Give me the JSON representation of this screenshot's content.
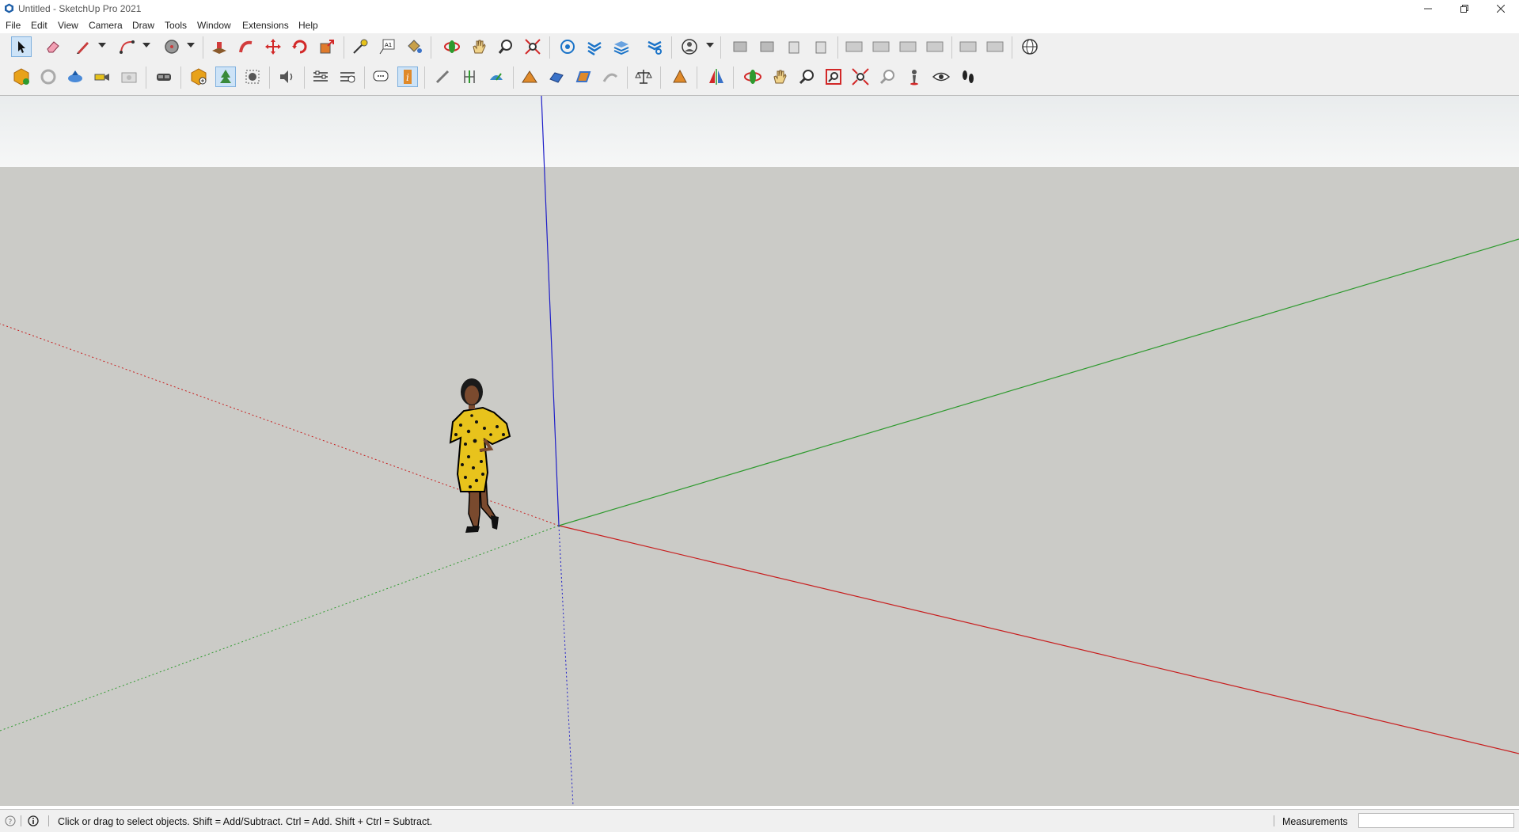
{
  "window": {
    "title": "Untitled - SketchUp Pro 2021",
    "controls": [
      "minimize-icon",
      "restore-icon",
      "close-icon"
    ]
  },
  "menubar": {
    "items": [
      {
        "label": "File"
      },
      {
        "label": "Edit"
      },
      {
        "label": "View"
      },
      {
        "label": "Camera"
      },
      {
        "label": "Draw"
      },
      {
        "label": "Tools"
      },
      {
        "label": "Window"
      },
      {
        "label": "Extensions"
      },
      {
        "label": "Help"
      }
    ]
  },
  "toolbar": {
    "row1": [
      "select-icon",
      "eraser-icon",
      "pencil-line-icon",
      "arc-icon",
      "circle-icon",
      "push-pull-icon",
      "follow-me-icon",
      "move-icon",
      "rotate-icon",
      "scale-icon",
      "tape-measure-icon",
      "text-icon",
      "paint-bucket-icon",
      "orbit-icon",
      "pan-icon",
      "zoom-icon",
      "zoom-extents-icon",
      "components-icon",
      "styles-icon",
      "tags-icon",
      "scenes-icon",
      "account-icon",
      "standard-views-icons",
      "geo-location-icon"
    ],
    "row2": [
      "warehouse-icon",
      "sync-icon",
      "share-model-icon",
      "camera-icon",
      "photo-icon",
      "vr-icon",
      "component-add-icon",
      "tree-icon",
      "bounding-box-icon",
      "sound-icon",
      "settings-icon",
      "panels-icon",
      "chat-icon",
      "info-icon",
      "tape-icon",
      "dimension-icon",
      "protractor-icon",
      "sandbox-icon",
      "stamp-icon",
      "drape-icon",
      "flip-edge-icon",
      "scale-balance-icon",
      "section-plane-icon",
      "mirror-icon",
      "orbit-icon",
      "pan-icon",
      "zoom-icon",
      "zoom-window-icon",
      "zoom-extents-icon",
      "previous-icon",
      "position-camera-icon",
      "look-around-icon",
      "walk-icon"
    ],
    "accent": "#1a73c8"
  },
  "viewport": {
    "background": "#cbcbc7",
    "sky": "#eef0f0",
    "axes": {
      "red": "#c81e1e",
      "green": "#2e9a2e",
      "blue": "#1f1fc8"
    },
    "figure": {
      "dress": "#e8c31c",
      "skin": "#7a4a2e"
    }
  },
  "statusbar": {
    "message": "Click or drag to select objects. Shift = Add/Subtract. Ctrl = Add. Shift + Ctrl = Subtract.",
    "measurements_label": "Measurements",
    "measurements_value": ""
  }
}
